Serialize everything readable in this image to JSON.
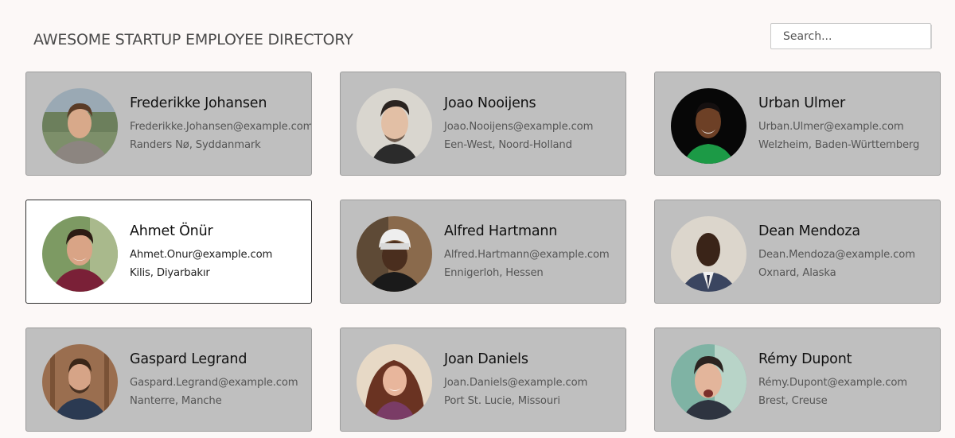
{
  "header": {
    "title": "AWESOME STARTUP EMPLOYEE DIRECTORY"
  },
  "search": {
    "placeholder": "Search..."
  },
  "employees": [
    {
      "name": "Frederikke Johansen",
      "email": "Frederikke.Johansen@example.com",
      "location": "Randers Nø, Syddanmark",
      "selected": false
    },
    {
      "name": "Joao Nooijens",
      "email": "Joao.Nooijens@example.com",
      "location": "Een-West, Noord-Holland",
      "selected": false
    },
    {
      "name": "Urban Ulmer",
      "email": "Urban.Ulmer@example.com",
      "location": "Welzheim, Baden-Württemberg",
      "selected": false
    },
    {
      "name": "Ahmet Önür",
      "email": "Ahmet.Onur@example.com",
      "location": "Kilis, Diyarbakır",
      "selected": true
    },
    {
      "name": "Alfred Hartmann",
      "email": "Alfred.Hartmann@example.com",
      "location": "Ennigerloh, Hessen",
      "selected": false
    },
    {
      "name": "Dean Mendoza",
      "email": "Dean.Mendoza@example.com",
      "location": "Oxnard, Alaska",
      "selected": false
    },
    {
      "name": "Gaspard Legrand",
      "email": "Gaspard.Legrand@example.com",
      "location": "Nanterre, Manche",
      "selected": false
    },
    {
      "name": "Joan Daniels",
      "email": "Joan.Daniels@example.com",
      "location": "Port St. Lucie, Missouri",
      "selected": false
    },
    {
      "name": "Rémy Dupont",
      "email": "Rémy.Dupont@example.com",
      "location": "Brest, Creuse",
      "selected": false
    }
  ]
}
